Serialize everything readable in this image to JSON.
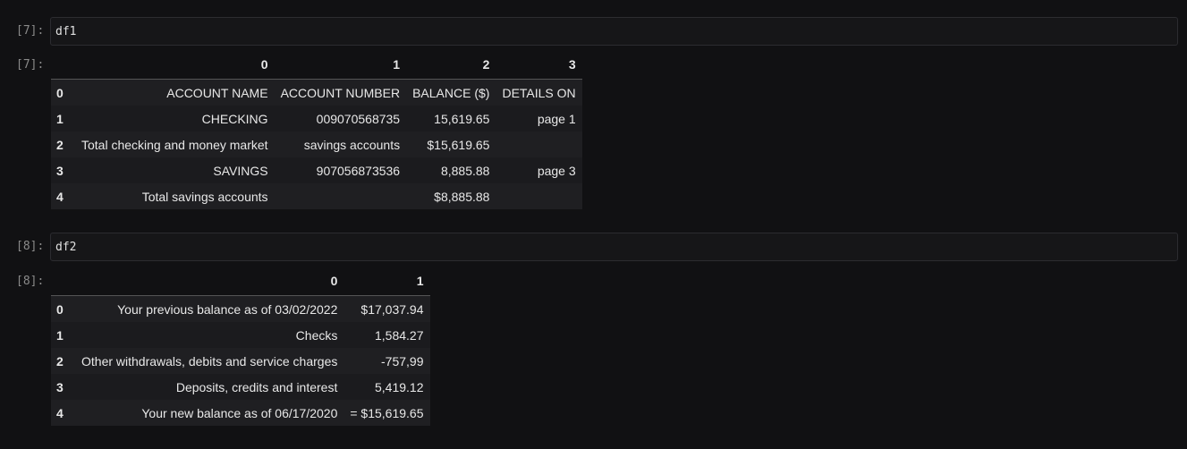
{
  "cells": [
    {
      "in_prompt": "[7]:",
      "code": "df1",
      "out_prompt": "[7]:",
      "table": {
        "columns": [
          "0",
          "1",
          "2",
          "3"
        ],
        "rows": [
          {
            "index": "0",
            "cells": [
              "ACCOUNT NAME",
              "ACCOUNT NUMBER",
              "BALANCE ($)",
              "DETAILS ON"
            ]
          },
          {
            "index": "1",
            "cells": [
              "CHECKING",
              "009070568735",
              "15,619.65",
              "page 1"
            ]
          },
          {
            "index": "2",
            "cells": [
              "Total checking and money market",
              "savings accounts",
              "$15,619.65",
              ""
            ]
          },
          {
            "index": "3",
            "cells": [
              "SAVINGS",
              "907056873536",
              "8,885.88",
              "page 3"
            ]
          },
          {
            "index": "4",
            "cells": [
              "Total savings accounts",
              "",
              "$8,885.88",
              ""
            ]
          }
        ]
      }
    },
    {
      "in_prompt": "[8]:",
      "code": "df2",
      "out_prompt": "[8]:",
      "table": {
        "columns": [
          "0",
          "1"
        ],
        "rows": [
          {
            "index": "0",
            "cells": [
              "Your previous balance as of 03/02/2022",
              "$17,037.94"
            ]
          },
          {
            "index": "1",
            "cells": [
              "Checks",
              "1,584.27"
            ]
          },
          {
            "index": "2",
            "cells": [
              "Other withdrawals, debits and service charges",
              "-757,99"
            ]
          },
          {
            "index": "3",
            "cells": [
              "Deposits, credits and interest",
              "5,419.12"
            ]
          },
          {
            "index": "4",
            "cells": [
              "Your new balance as of 06/17/2020",
              "= $15,619.65"
            ]
          }
        ]
      }
    }
  ]
}
